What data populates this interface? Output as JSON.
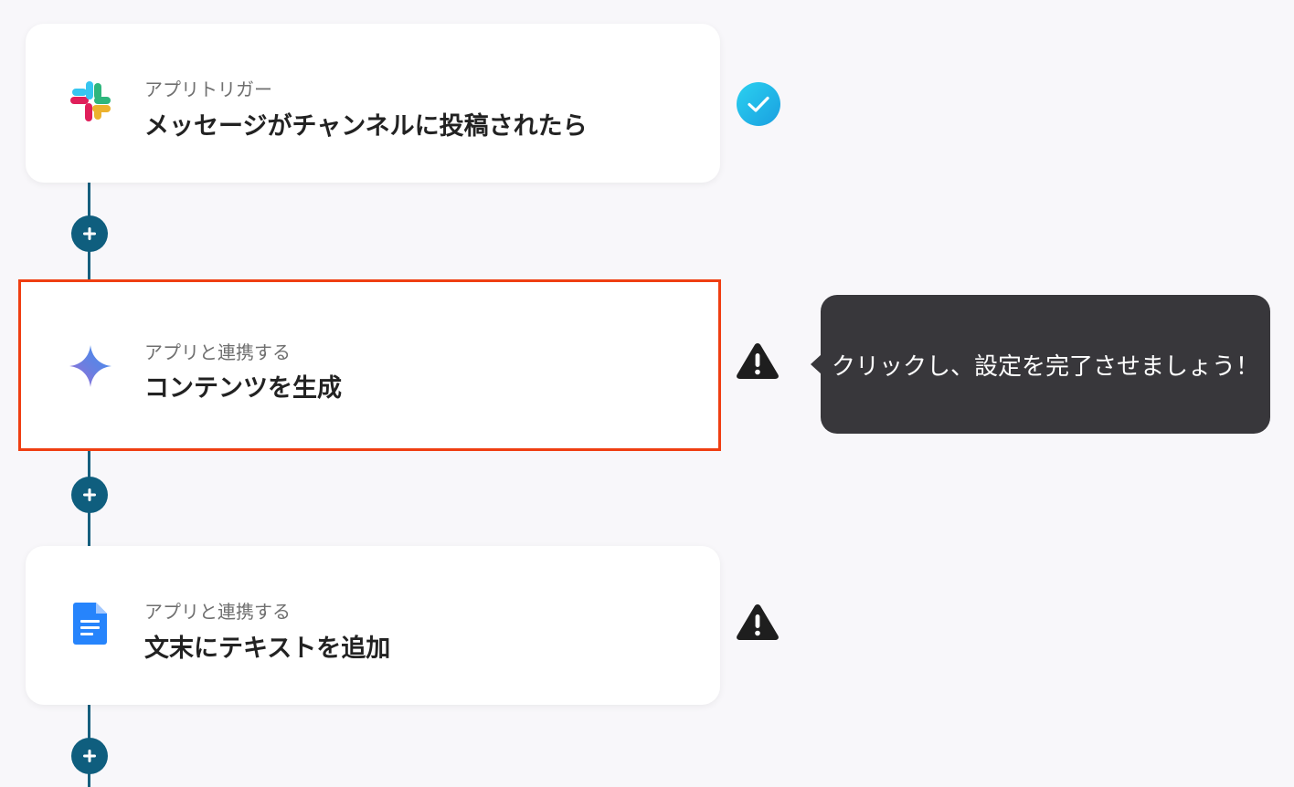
{
  "steps": [
    {
      "subtitle": "アプリトリガー",
      "title": "メッセージがチャンネルに投稿されたら",
      "app_icon": "slack-icon",
      "status": "completed",
      "status_icon": "check-circle-icon"
    },
    {
      "subtitle": "アプリと連携する",
      "title": "コンテンツを生成",
      "app_icon": "gemini-sparkle-icon",
      "status": "incomplete",
      "status_icon": "warning-icon"
    },
    {
      "subtitle": "アプリと連携する",
      "title": "文末にテキストを追加",
      "app_icon": "google-docs-icon",
      "status": "incomplete",
      "status_icon": "warning-icon"
    }
  ],
  "tooltip": {
    "text": "クリックし、設定を完了させましょう！"
  },
  "colors": {
    "connector": "#165f7e",
    "add_button": "#0f5e7e",
    "highlight_border": "#ef3e12",
    "tooltip_bg": "#38373b",
    "check_gradient_start": "#25c7f0",
    "check_gradient_end": "#1aa3e0"
  },
  "icons": {
    "add_button": "plus-icon",
    "tooltip_arrow": "tooltip-arrow"
  }
}
